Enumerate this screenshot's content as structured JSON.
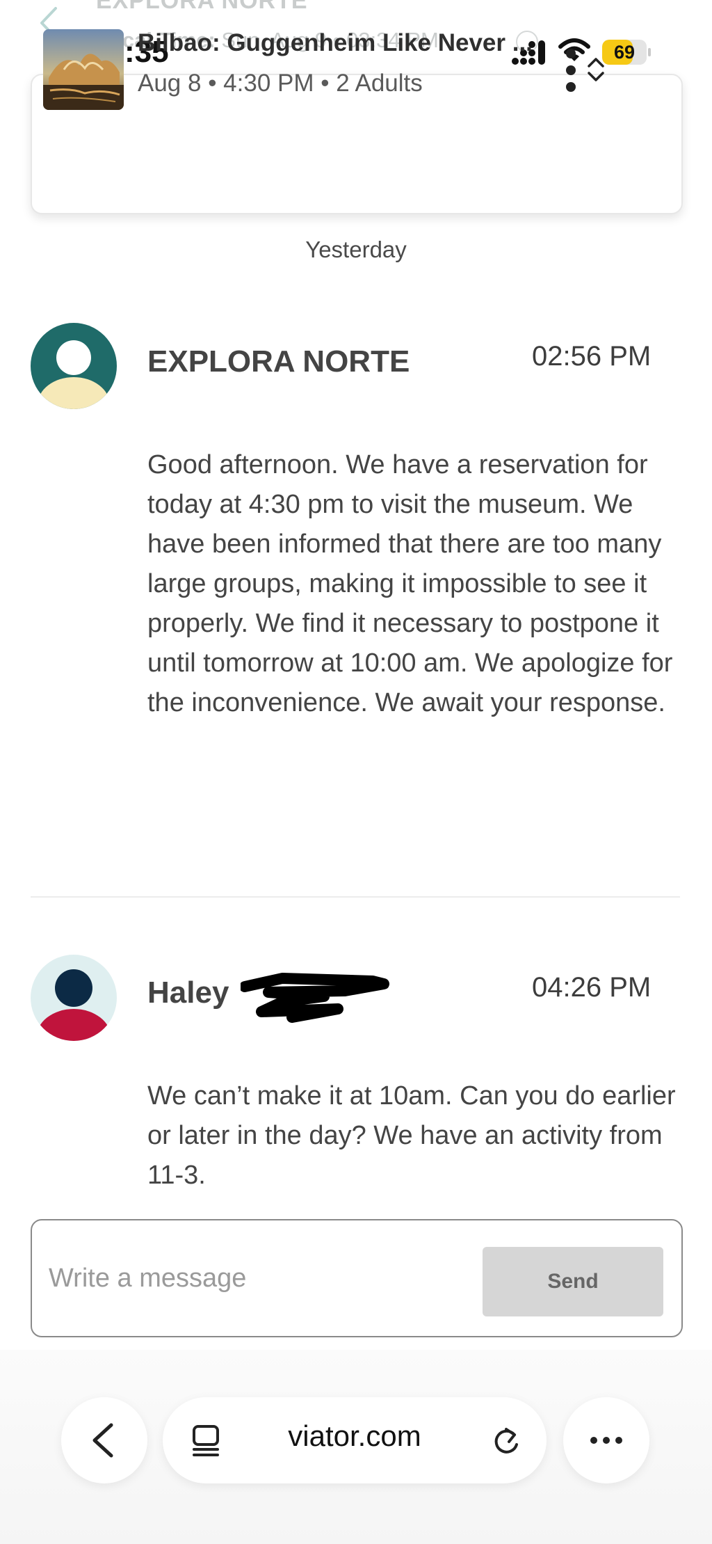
{
  "header": {
    "title": "EXPLORA NORTE",
    "local_time_label": "Local Time:",
    "local_time_value": "Sun, Aug 9 • 03:34 PM"
  },
  "status_bar": {
    "time": "15:35",
    "battery_level": "69",
    "battery_fraction": 0.69
  },
  "booking": {
    "title": "Bilbao: Guggenheim Like Never ...",
    "details": "Aug 8 • 4:30 PM • 2 Adults"
  },
  "date_divider": "Yesterday",
  "messages": [
    {
      "sender": "EXPLORA NORTE",
      "time": "02:56 PM",
      "text": "Good afternoon. We have a reservation for today at 4:30 pm to visit the museum. We have been informed that there are too many large groups, making it impossible to see it properly. We find it necessary to postpone it until tomorrow at 10:00 am. We apologize for the inconvenience. We await your response."
    },
    {
      "sender": "Haley",
      "time": "04:26 PM",
      "text": "We can’t make it at 10am. Can you do earlier or later in the day? We have an activity from 11-3."
    }
  ],
  "composer": {
    "placeholder": "Write a message",
    "send_label": "Send"
  },
  "browser": {
    "url": "viator.com"
  },
  "colors": {
    "battery_yellow": "#f6c915",
    "avatar1_bg": "#1f6b69",
    "avatar1_body": "#f6e9b8",
    "avatar2_bg": "#dfeff0",
    "avatar2_head": "#0c2a45",
    "avatar2_body": "#c0143c",
    "send_button_bg": "#d6d6d6"
  }
}
